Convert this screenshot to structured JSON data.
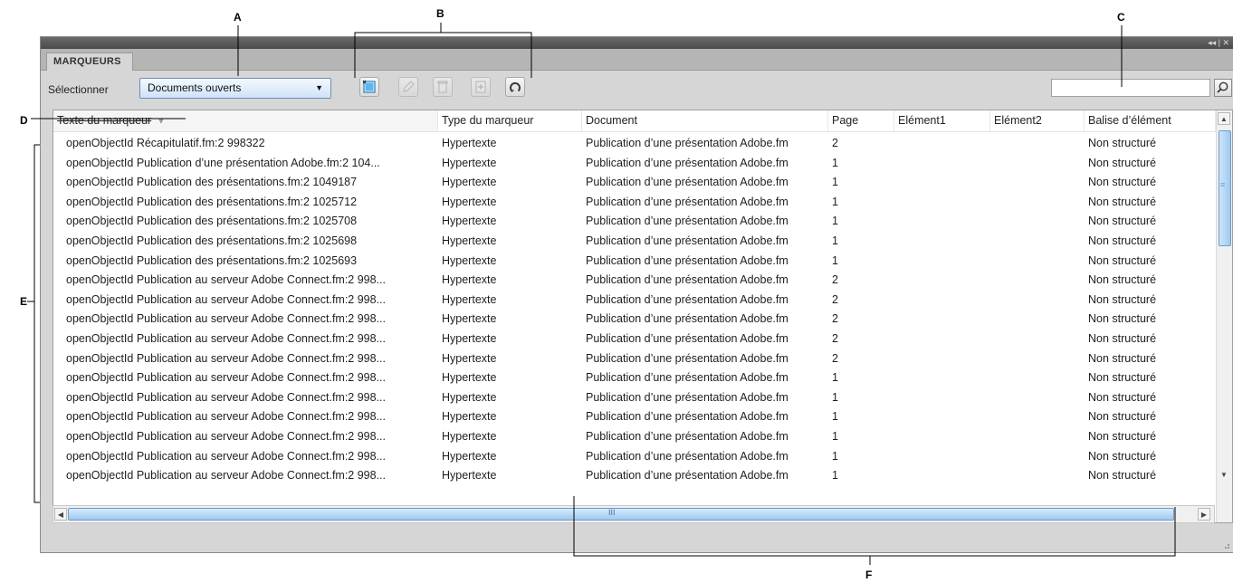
{
  "callouts": {
    "a": "A",
    "b": "B",
    "c": "C",
    "d": "D",
    "e": "E",
    "f": "F"
  },
  "panel": {
    "tab_label": "MARQUEURS",
    "window_controls": "◂◂ | ✕"
  },
  "toolbar": {
    "select_label": "Sélectionner",
    "select_value": "Documents ouverts",
    "buttons": [
      {
        "icon": "new-marker-icon",
        "enabled": true
      },
      {
        "icon": "edit-marker-icon",
        "enabled": false
      },
      {
        "icon": "delete-marker-icon",
        "enabled": false
      },
      {
        "icon": "convert-marker-icon",
        "enabled": false
      },
      {
        "icon": "refresh-icon",
        "enabled": true
      }
    ],
    "search_value": ""
  },
  "table": {
    "columns": [
      "Texte du marqueur",
      "Type du marqueur",
      "Document",
      "Page",
      "Elément1",
      "Elément2",
      "Balise d’élément"
    ],
    "sort_indicator": "▾",
    "rows": [
      [
        "openObjectId Récapitulatif.fm:2 998322",
        "Hypertexte",
        "Publication d’une présentation Adobe.fm",
        "2",
        "",
        "",
        "Non structuré"
      ],
      [
        "openObjectId Publication d’une présentation Adobe.fm:2 104...",
        "Hypertexte",
        "Publication d’une présentation Adobe.fm",
        "1",
        "",
        "",
        "Non structuré"
      ],
      [
        "openObjectId Publication des présentations.fm:2 1049187",
        "Hypertexte",
        "Publication d’une présentation Adobe.fm",
        "1",
        "",
        "",
        "Non structuré"
      ],
      [
        "openObjectId Publication des présentations.fm:2 1025712",
        "Hypertexte",
        "Publication d’une présentation Adobe.fm",
        "1",
        "",
        "",
        "Non structuré"
      ],
      [
        "openObjectId Publication des présentations.fm:2 1025708",
        "Hypertexte",
        "Publication d’une présentation Adobe.fm",
        "1",
        "",
        "",
        "Non structuré"
      ],
      [
        "openObjectId Publication des présentations.fm:2 1025698",
        "Hypertexte",
        "Publication d’une présentation Adobe.fm",
        "1",
        "",
        "",
        "Non structuré"
      ],
      [
        "openObjectId Publication des présentations.fm:2 1025693",
        "Hypertexte",
        "Publication d’une présentation Adobe.fm",
        "1",
        "",
        "",
        "Non structuré"
      ],
      [
        "openObjectId Publication au serveur Adobe Connect.fm:2 998...",
        "Hypertexte",
        "Publication d’une présentation Adobe.fm",
        "2",
        "",
        "",
        "Non structuré"
      ],
      [
        "openObjectId Publication au serveur Adobe Connect.fm:2 998...",
        "Hypertexte",
        "Publication d’une présentation Adobe.fm",
        "2",
        "",
        "",
        "Non structuré"
      ],
      [
        "openObjectId Publication au serveur Adobe Connect.fm:2 998...",
        "Hypertexte",
        "Publication d’une présentation Adobe.fm",
        "2",
        "",
        "",
        "Non structuré"
      ],
      [
        "openObjectId Publication au serveur Adobe Connect.fm:2 998...",
        "Hypertexte",
        "Publication d’une présentation Adobe.fm",
        "2",
        "",
        "",
        "Non structuré"
      ],
      [
        "openObjectId Publication au serveur Adobe Connect.fm:2 998...",
        "Hypertexte",
        "Publication d’une présentation Adobe.fm",
        "2",
        "",
        "",
        "Non structuré"
      ],
      [
        "openObjectId Publication au serveur Adobe Connect.fm:2 998...",
        "Hypertexte",
        "Publication d’une présentation Adobe.fm",
        "1",
        "",
        "",
        "Non structuré"
      ],
      [
        "openObjectId Publication au serveur Adobe Connect.fm:2 998...",
        "Hypertexte",
        "Publication d’une présentation Adobe.fm",
        "1",
        "",
        "",
        "Non structuré"
      ],
      [
        "openObjectId Publication au serveur Adobe Connect.fm:2 998...",
        "Hypertexte",
        "Publication d’une présentation Adobe.fm",
        "1",
        "",
        "",
        "Non structuré"
      ],
      [
        "openObjectId Publication au serveur Adobe Connect.fm:2 998...",
        "Hypertexte",
        "Publication d’une présentation Adobe.fm",
        "1",
        "",
        "",
        "Non structuré"
      ],
      [
        "openObjectId Publication au serveur Adobe Connect.fm:2 998...",
        "Hypertexte",
        "Publication d’une présentation Adobe.fm",
        "1",
        "",
        "",
        "Non structuré"
      ],
      [
        "openObjectId Publication au serveur Adobe Connect.fm:2 998...",
        "Hypertexte",
        "Publication d’une présentation Adobe.fm",
        "1",
        "",
        "",
        "Non structuré"
      ]
    ]
  },
  "scrollbar": {
    "grip": "III"
  },
  "colors": {
    "accent": "#9fc9ee",
    "panel_bg": "#d6d6d6",
    "title_bar": "#4a4a4a"
  }
}
